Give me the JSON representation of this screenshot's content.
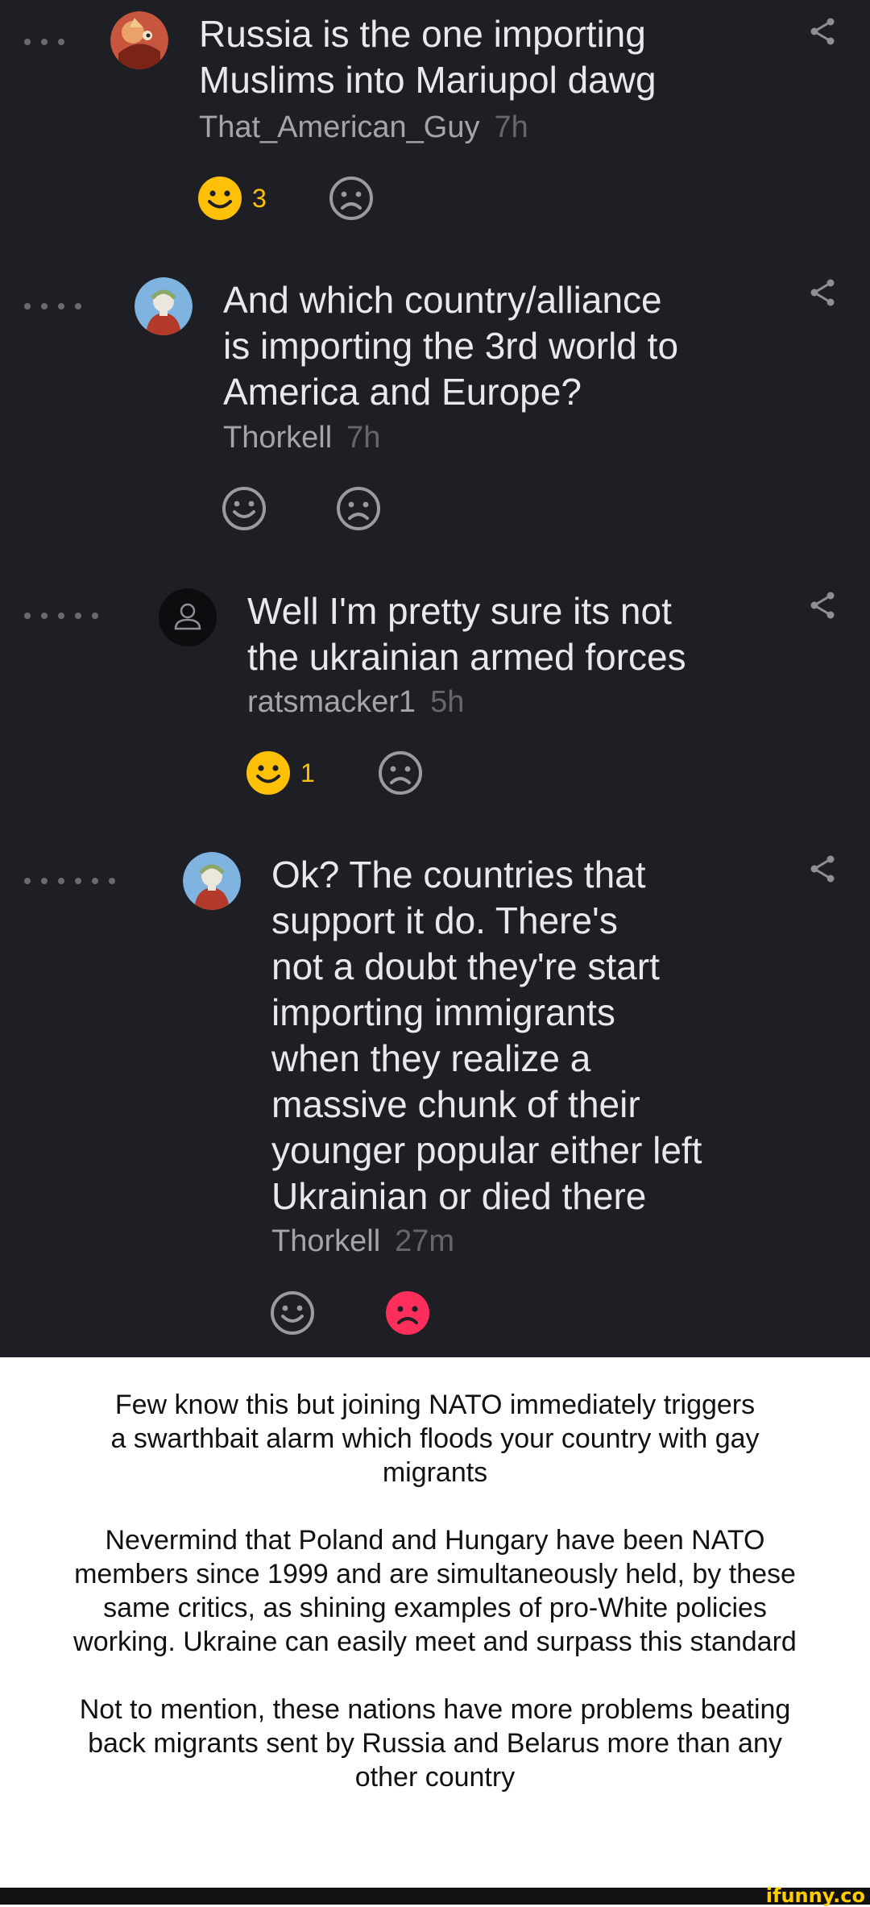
{
  "comments": [
    {
      "text_lines": [
        "Russia is the one importing",
        "Muslims into Mariupol dawg"
      ],
      "author": "That_American_Guy",
      "time": "7h",
      "smile_count": "3",
      "avatar_icon": "dragon-avatar",
      "smile_state": "active",
      "frown_state": "inactive"
    },
    {
      "text_lines": [
        "And which country/alliance",
        "is importing the 3rd world to",
        "America and Europe?"
      ],
      "author": "Thorkell",
      "time": "7h",
      "smile_count": "",
      "avatar_icon": "statue-avatar",
      "smile_state": "inactive",
      "frown_state": "inactive"
    },
    {
      "text_lines": [
        "Well I'm pretty sure its not",
        "the ukrainian armed forces"
      ],
      "author": "ratsmacker1",
      "time": "5h",
      "smile_count": "1",
      "avatar_icon": "default-user-avatar",
      "smile_state": "active",
      "frown_state": "inactive"
    },
    {
      "text_lines": [
        "Ok? The countries that",
        "support it do. There's",
        "not a doubt they're start",
        "importing immigrants",
        "when they realize a",
        "massive chunk of their",
        "younger popular either left",
        "Ukrainian or died there"
      ],
      "author": "Thorkell",
      "time": "27m",
      "smile_count": "",
      "avatar_icon": "statue-avatar",
      "smile_state": "inactive",
      "frown_state": "active"
    }
  ],
  "caption": {
    "p1": [
      "Few know this but joining NATO immediately triggers",
      "a swarthbait alarm which floods your country with gay",
      "migrants"
    ],
    "p2": [
      "Nevermind that Poland and Hungary have been NATO",
      "members since 1999 and are simultaneously held, by these",
      "same critics, as shining examples of pro-White policies",
      "working. Ukraine can easily meet and surpass this standard"
    ],
    "p3": [
      "Not to mention, these nations have more problems beating",
      "back migrants sent by Russia and Belarus more than any",
      "other country"
    ]
  },
  "footer": {
    "brand": "ifunny.co"
  },
  "colors": {
    "background_dark": "#1e1f24",
    "smile_active": "#ffc107",
    "frown_active": "#ff2e5b",
    "reaction_inactive": "#9a9ba0"
  }
}
